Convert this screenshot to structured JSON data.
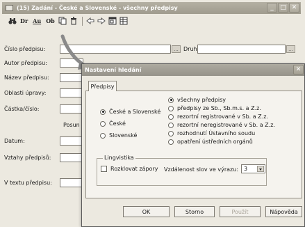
{
  "window": {
    "title": "(15) Zadání - České a Slovenské - všechny předpisy",
    "min_label": "_",
    "max_label": "□",
    "close_label": "✕"
  },
  "toolbar": {
    "items": [
      "Dr",
      "Au",
      "Ob"
    ]
  },
  "form": {
    "cislo_label": "Číslo předpisu:",
    "druh_label": "Druh:",
    "autor_label": "Autor předpisu:",
    "nazev_label": "Název předpisu:",
    "oblasti_label": "Oblasti úpravy:",
    "castka_label": "Částka/číslo:",
    "posun_label": "Posun",
    "datum_label": "Datum:",
    "vztahy_label": "Vztahy předpisů:",
    "textu_label": "V textu předpisu:",
    "dots": "..."
  },
  "dialog": {
    "title": "Nastavení hledání",
    "close_label": "✕",
    "tab_label": "Předpisy",
    "region_options": [
      {
        "label": "České a Slovenské",
        "selected": true
      },
      {
        "label": "České",
        "selected": false
      },
      {
        "label": "Slovenské",
        "selected": false
      }
    ],
    "scope_options": [
      {
        "label": "všechny předpisy",
        "selected": true
      },
      {
        "label": "předpisy ze Sb., Sb.m.s. a Z.z.",
        "selected": false
      },
      {
        "label": "rezortní registrované v Sb. a Z.z.",
        "selected": false
      },
      {
        "label": "rezortní neregistrované v Sb. a Z.z.",
        "selected": false
      },
      {
        "label": "rozhodnutí Ústavního soudu",
        "selected": false
      },
      {
        "label": "opatření ústředních orgánů",
        "selected": false
      }
    ],
    "lingvistika": {
      "legend": "Lingvistika",
      "checkbox_label": "Rozklovat zápory",
      "checked": false,
      "distance_label": "Vzdálenost slov ve výrazu:",
      "distance_value": "3"
    },
    "buttons": {
      "ok": "OK",
      "storno": "Storno",
      "pouzit": "Použít",
      "napoveda": "Nápověda"
    }
  },
  "colors": {
    "title_bar": "#a8a497",
    "window_bg": "#ece9e0",
    "arrow": "#8a8a8a"
  }
}
